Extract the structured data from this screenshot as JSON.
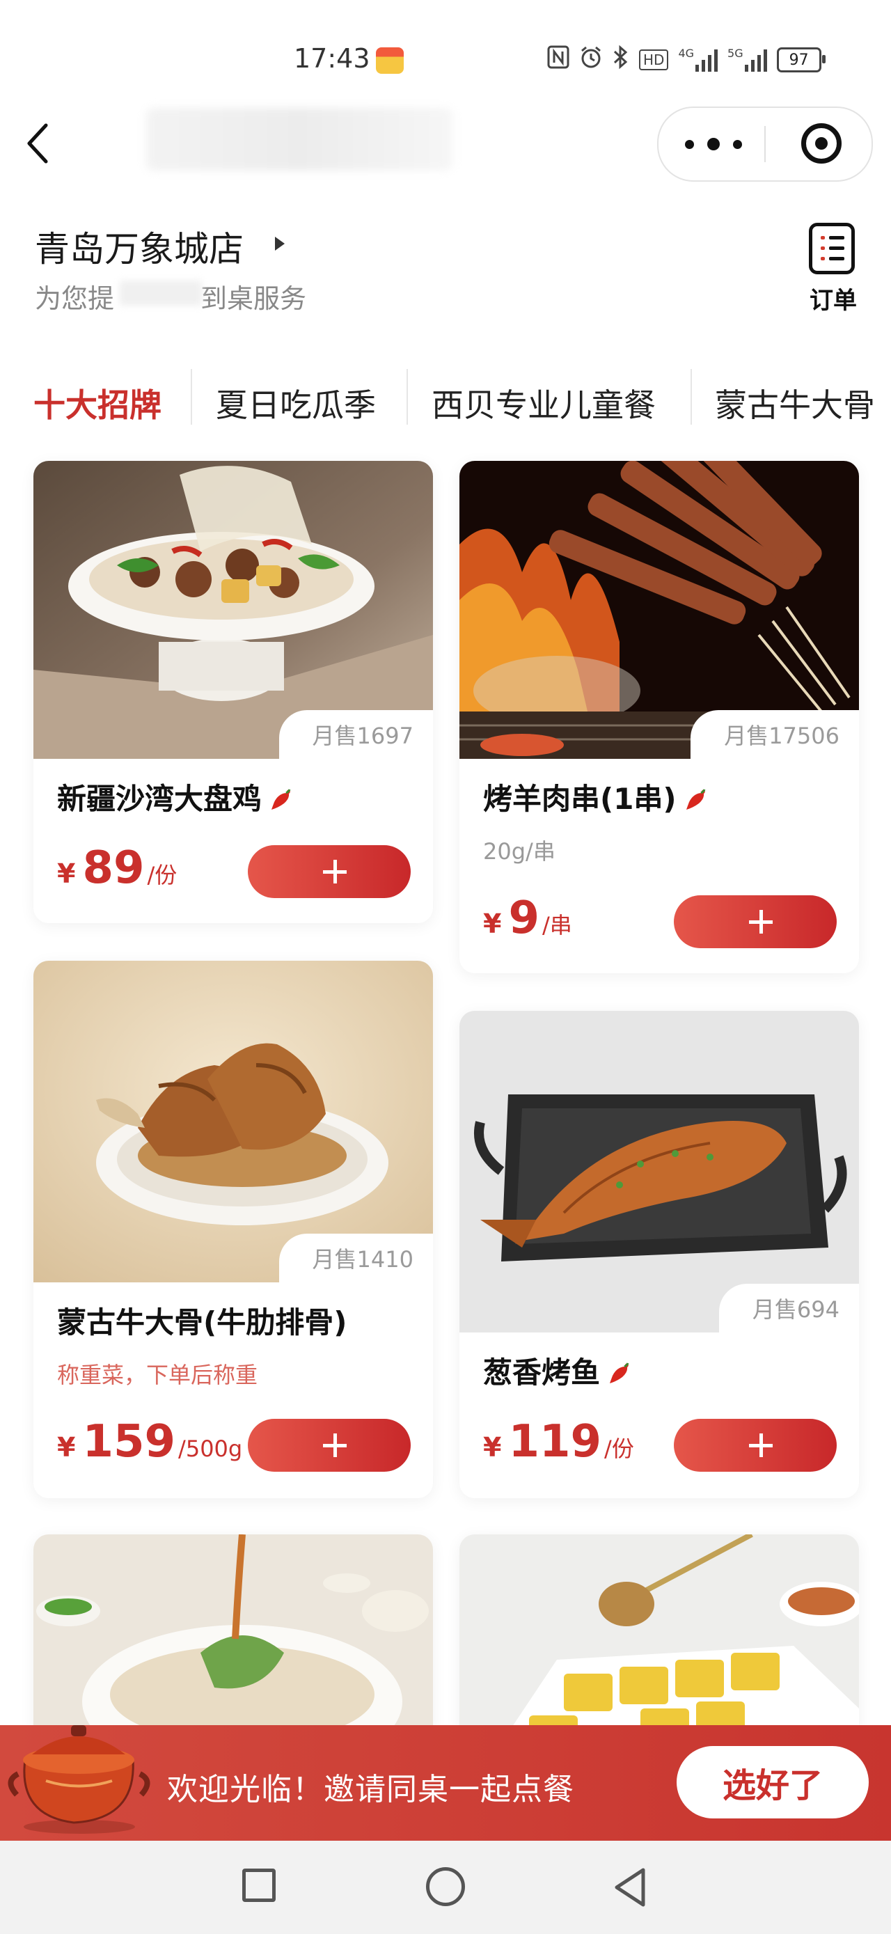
{
  "status_bar": {
    "time": "17:43",
    "icons": [
      "nfc-icon",
      "alarm-icon",
      "bluetooth-icon",
      "hd-icon",
      "signal-4g-icon",
      "signal-5g-icon"
    ],
    "hd_label": "HD",
    "net_4g": "4G",
    "net_5g": "5G",
    "battery": "97"
  },
  "store": {
    "name": "青岛万象城店",
    "subtitle_prefix": "为您提",
    "subtitle_suffix": "到桌服务",
    "order_label": "订单"
  },
  "tabs": [
    "十大招牌",
    "夏日吃瓜季",
    "西贝专业儿童餐",
    "蒙古牛大骨"
  ],
  "products": [
    {
      "name": "新疆沙湾大盘鸡",
      "spicy": true,
      "sales": "月售1697",
      "spec": "",
      "currency": "¥",
      "price": "89",
      "unit": "/份"
    },
    {
      "name": "烤羊肉串(1串)",
      "spicy": true,
      "sales": "月售17506",
      "spec": "20g/串",
      "currency": "¥",
      "price": "9",
      "unit": "/串"
    },
    {
      "name": "蒙古牛大骨(牛肋排骨)",
      "spicy": false,
      "sales": "月售1410",
      "spec": "称重菜，下单后称重",
      "currency": "¥",
      "price": "159",
      "unit": "/500g"
    },
    {
      "name": "葱香烤鱼",
      "spicy": true,
      "sales": "月售694",
      "spec": "",
      "currency": "¥",
      "price": "119",
      "unit": "/份"
    }
  ],
  "banner": {
    "text": "欢迎光临！邀请同桌一起点餐",
    "button": "选好了"
  },
  "colors": {
    "brand_red": "#c9302c",
    "banner_red": "#cf4139",
    "button_gradient_start": "#e5564a",
    "button_gradient_end": "#c8282a"
  }
}
